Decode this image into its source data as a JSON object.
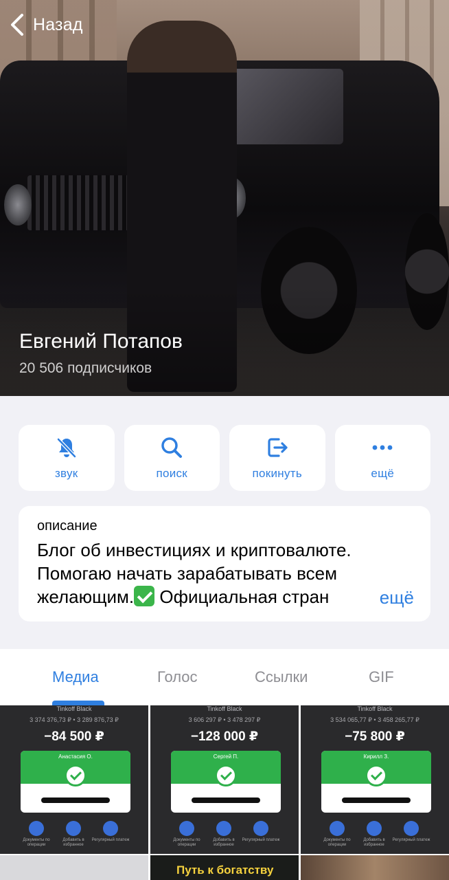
{
  "header": {
    "back_label": "Назад"
  },
  "channel": {
    "name": "Евгений Потапов",
    "subscribers": "20 506 подписчиков"
  },
  "actions": [
    {
      "label": "звук",
      "icon": "bell-muted-icon"
    },
    {
      "label": "поиск",
      "icon": "search-icon"
    },
    {
      "label": "покинуть",
      "icon": "leave-icon"
    },
    {
      "label": "ещё",
      "icon": "more-icon"
    }
  ],
  "description": {
    "heading": "описание",
    "text_line1": "Блог об инвестициях и криптовалюте.",
    "text_line2": "Помогаю начать зарабатывать всем",
    "text_line3_a": "желающим.",
    "text_line3_b": "Официальная стран",
    "more": "ещё"
  },
  "tabs": [
    {
      "label": "Медиа",
      "active": true
    },
    {
      "label": "Голос",
      "active": false
    },
    {
      "label": "Ссылки",
      "active": false
    },
    {
      "label": "GIF",
      "active": false
    }
  ],
  "media": [
    {
      "bank": "Tinkoff Black",
      "balance": "3 374 376,73 ₽  •  3 289 876,73 ₽",
      "amount": "−84 500 ₽",
      "name": "Анастасия О."
    },
    {
      "bank": "Tinkoff Black",
      "balance": "3 606 297 ₽  •  3 478 297 ₽",
      "amount": "−128 000 ₽",
      "name": "Сергей П."
    },
    {
      "bank": "Tinkoff Black",
      "balance": "3 534 065,77 ₽  •  3 458 265,77 ₽",
      "amount": "−75 800 ₽",
      "name": "Кирилл З."
    }
  ],
  "media_icons": [
    "Документы по операции",
    "Добавить в избранное",
    "Регулярный платеж"
  ],
  "media_row2": {
    "title": "Путь к богатству"
  },
  "colors": {
    "accent": "#2f7fe0",
    "background": "#f1f1f6",
    "success": "#2fb04b"
  }
}
